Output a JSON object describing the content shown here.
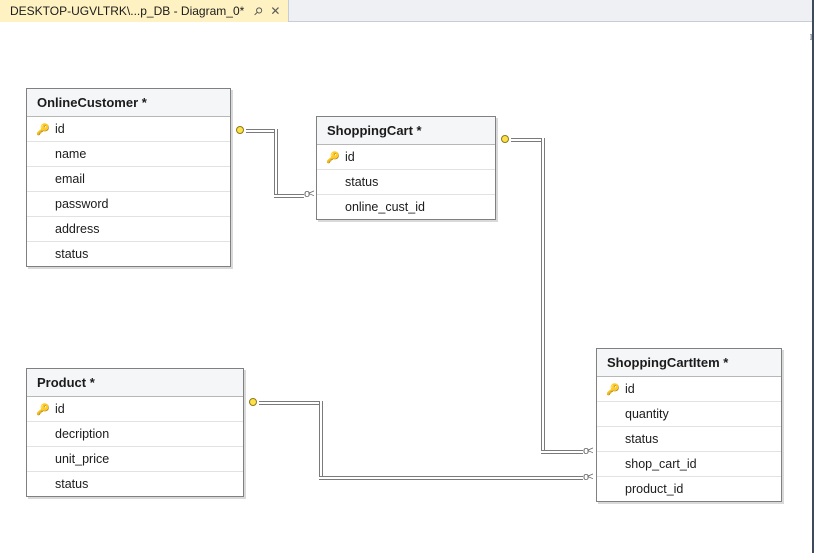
{
  "tab": {
    "label": "DESKTOP-UGVLTRK\\...p_DB - Diagram_0*"
  },
  "entities": {
    "onlineCustomer": {
      "title": "OnlineCustomer *",
      "columns": [
        "id",
        "name",
        "email",
        "password",
        "address",
        "status"
      ],
      "keys": [
        true,
        false,
        false,
        false,
        false,
        false
      ]
    },
    "shoppingCart": {
      "title": "ShoppingCart *",
      "columns": [
        "id",
        "status",
        "online_cust_id"
      ],
      "keys": [
        true,
        false,
        false
      ]
    },
    "product": {
      "title": "Product *",
      "columns": [
        "id",
        "decription",
        "unit_price",
        "status"
      ],
      "keys": [
        true,
        false,
        false,
        false
      ]
    },
    "shoppingCartItem": {
      "title": "ShoppingCartItem *",
      "columns": [
        "id",
        "quantity",
        "status",
        "shop_cart_id",
        "product_id"
      ],
      "keys": [
        true,
        false,
        false,
        false,
        false
      ]
    }
  },
  "chart_data": {
    "type": "table",
    "title": "Diagram_0",
    "tables": [
      {
        "name": "OnlineCustomer",
        "primary_key": "id",
        "columns": [
          "id",
          "name",
          "email",
          "password",
          "address",
          "status"
        ]
      },
      {
        "name": "ShoppingCart",
        "primary_key": "id",
        "columns": [
          "id",
          "status",
          "online_cust_id"
        ]
      },
      {
        "name": "Product",
        "primary_key": "id",
        "columns": [
          "id",
          "decription",
          "unit_price",
          "status"
        ]
      },
      {
        "name": "ShoppingCartItem",
        "primary_key": "id",
        "columns": [
          "id",
          "quantity",
          "status",
          "shop_cart_id",
          "product_id"
        ]
      }
    ],
    "relationships": [
      {
        "from": "ShoppingCart.online_cust_id",
        "to": "OnlineCustomer.id",
        "type": "many-to-one"
      },
      {
        "from": "ShoppingCartItem.shop_cart_id",
        "to": "ShoppingCart.id",
        "type": "many-to-one"
      },
      {
        "from": "ShoppingCartItem.product_id",
        "to": "Product.id",
        "type": "many-to-one"
      }
    ]
  }
}
